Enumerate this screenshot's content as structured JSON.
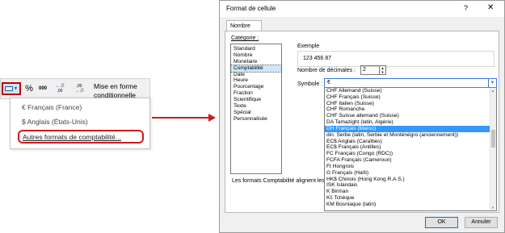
{
  "ribbon": {
    "percent_label": "%",
    "thousands_label": "000",
    "increase_decimal_top": "←,0",
    "increase_decimal_bottom": ",00",
    "decrease_decimal_top": ",00",
    "decrease_decimal_bottom": "→,0",
    "conditional_format_line1": "Mise en forme",
    "conditional_format_line2": "conditionnelle"
  },
  "accounting_menu": {
    "items": [
      {
        "label": "€ Français (France)"
      },
      {
        "label": "$ Anglais (États-Unis)"
      },
      {
        "label": "Autres formats de comptabilité..."
      }
    ]
  },
  "dialog": {
    "title": "Format de cellule",
    "help_label": "?",
    "close_label": "✕",
    "tab_label": "Nombre",
    "category_label": "Catégorie :",
    "categories": [
      "Standard",
      "Nombre",
      "Monétaire",
      "Comptabilité",
      "Date",
      "Heure",
      "Pourcentage",
      "Fraction",
      "Scientifique",
      "Texte",
      "Spécial",
      "Personnalisée"
    ],
    "selected_category": "Comptabilité",
    "example_label": "Exemple",
    "example_value": "123 456 87",
    "decimals_label": "Nombre de décimales :",
    "decimals_value": "2",
    "symbol_label": "Symbole :",
    "symbol_value": "€",
    "symbol_options": [
      "CHF Allemand (Suisse)",
      "CHF Français (Suisse)",
      "CHF Italien (Suisse)",
      "CHF Romanche",
      "CHF Suisse allemand (Suisse)",
      "DA Tamazight (latin, Algérie)",
      "DH Français (Maroc)",
      "din. Serbe (latin, Serbie et Monténégro (anciennement))",
      "EC$ Anglais (Caraïbes)",
      "EC$ Français (Antilles)",
      "FC Français (Congo (RDC))",
      "FCFA Français (Cameroun)",
      "Ft Hongrois",
      "G Français (Haïti)",
      "HK$ Chinois (Hong Kong R.A.S.)",
      "ISK Islandais",
      "K Birman",
      "Kč Tchèque",
      "KM Bosniaque (latin)"
    ],
    "selected_symbol": "DH Français (Maroc)",
    "description": "Les formats Comptabilité alignent les",
    "ok_label": "OK",
    "cancel_label": "Annuler"
  },
  "colors": {
    "highlight_red": "#d11a1a",
    "selection_blue": "#3399ff",
    "light_selection": "#cce8ff",
    "dialog_background": "#f0f0f0"
  }
}
